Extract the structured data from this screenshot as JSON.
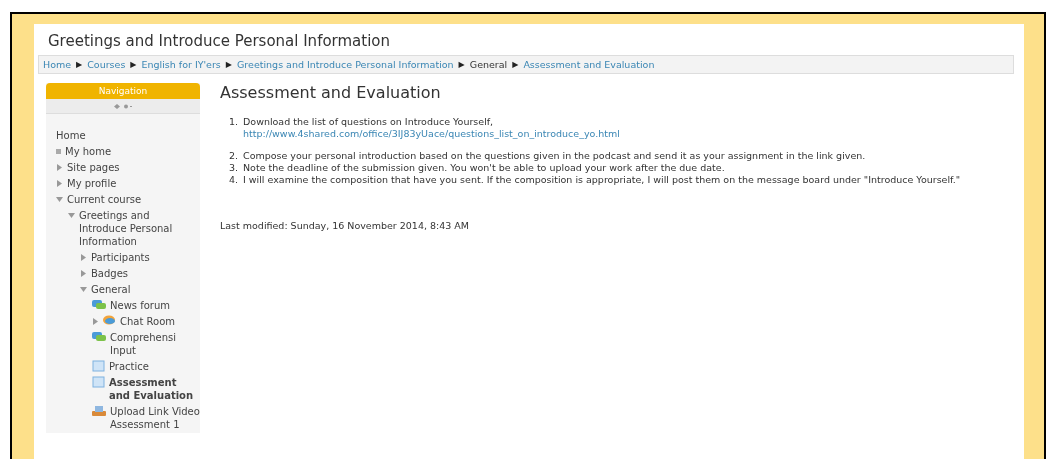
{
  "page_title": "Greetings and Introduce Personal Information",
  "breadcrumb": [
    {
      "label": "Home",
      "link": true
    },
    {
      "separator": "▶",
      "label": "Courses",
      "link": true
    },
    {
      "separator": "▶",
      "label": "English for IY'ers",
      "link": true
    },
    {
      "separator": "▶",
      "label": "Greetings and Introduce Personal Information",
      "link": true
    },
    {
      "separator": "▶",
      "label": "General",
      "link": false
    },
    {
      "separator": "▶",
      "label": "Assessment and Evaluation",
      "link": true
    }
  ],
  "navigation": {
    "title": "Navigation",
    "items": [
      {
        "label": "Home",
        "kind": "root",
        "selected": false
      },
      {
        "label": "My home",
        "kind": "leaf",
        "selected": false
      },
      {
        "label": "Site pages",
        "kind": "branch",
        "expanded": false,
        "selected": false
      },
      {
        "label": "My profile",
        "kind": "branch",
        "expanded": false,
        "selected": false
      },
      {
        "label": "Current course",
        "kind": "branch",
        "expanded": true,
        "selected": false,
        "children": [
          {
            "label": "Greetings and Introduce Personal Information",
            "kind": "branch",
            "expanded": true,
            "selected": false,
            "children": [
              {
                "label": "Participants",
                "kind": "branch",
                "expanded": false,
                "selected": false
              },
              {
                "label": "Badges",
                "kind": "branch",
                "expanded": false,
                "selected": false
              },
              {
                "label": "General",
                "kind": "branch",
                "expanded": true,
                "selected": false,
                "children": [
                  {
                    "label": "News forum",
                    "kind": "forum",
                    "selected": false
                  },
                  {
                    "label": "Chat Room",
                    "kind": "chat",
                    "expanded": false,
                    "selected": false
                  },
                  {
                    "label": "Comprehensi Input",
                    "kind": "forum",
                    "selected": false
                  },
                  {
                    "label": "Practice",
                    "kind": "page",
                    "selected": false
                  },
                  {
                    "label": "Assessment and Evaluation",
                    "kind": "page",
                    "selected": true
                  },
                  {
                    "label": "Upload Link Video Assessment 1",
                    "kind": "upload",
                    "selected": false
                  }
                ]
              }
            ]
          }
        ]
      }
    ]
  },
  "content": {
    "heading": "Assessment and Evaluation",
    "steps": [
      {
        "number": "1.",
        "text": "Download the list of questions on Introduce Yourself,",
        "link": "http://www.4shared.com/office/3IJ83yUace/questions_list_on_introduce_yo.html"
      },
      {
        "number": "2.",
        "text": "Compose your personal introduction based on the questions given in the podcast and send it as your assignment in the link given."
      },
      {
        "number": "3.",
        "text": "Note the deadline of the submission given. You won't be able to upload your work after the due date."
      },
      {
        "number": "4.",
        "text": "I will examine the composition that have you sent. If the composition is appropriate, I will post them on the message board under \"Introduce Yourself.\""
      }
    ],
    "last_modified": "Last modified: Sunday, 16 November 2014, 8:43 AM"
  }
}
